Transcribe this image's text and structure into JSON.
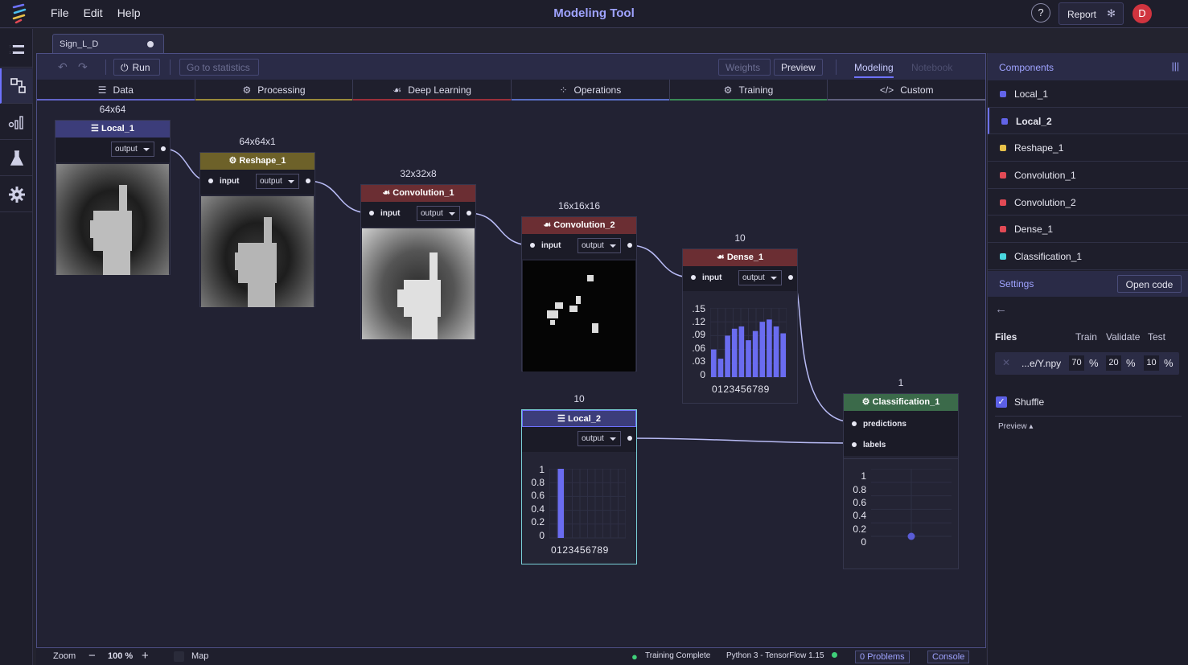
{
  "app": {
    "title": "Modeling Tool"
  },
  "menu": [
    "File",
    "Edit",
    "Help"
  ],
  "header": {
    "help": "?",
    "report": "Report",
    "avatar": "D"
  },
  "file_tab": {
    "name": "Sign_L_D"
  },
  "toolbar": {
    "run": "Run",
    "go_to_statistics": "Go to statistics",
    "weights": "Weights",
    "preview": "Preview",
    "modeling": "Modeling",
    "notebook": "Notebook"
  },
  "categories": [
    {
      "label": "Data",
      "icon": "database-icon",
      "color": "#6264c7"
    },
    {
      "label": "Processing",
      "icon": "gear-icon",
      "color": "#9a8a3a"
    },
    {
      "label": "Deep Learning",
      "icon": "brain-icon",
      "color": "#9b2f3a"
    },
    {
      "label": "Operations",
      "icon": "grid-icon",
      "color": "#5a6fc4"
    },
    {
      "label": "Training",
      "icon": "gear-icon",
      "color": "#3a8a56"
    },
    {
      "label": "Custom",
      "icon": "code-icon",
      "color": "#5f607e"
    }
  ],
  "nodes": {
    "local_1": {
      "title": "Local_1",
      "shape": "64x64",
      "output": "output",
      "color": "#3c3d7a"
    },
    "reshape_1": {
      "title": "Reshape_1",
      "shape": "64x64x1",
      "input": "input",
      "output": "output",
      "color": "#6d6129"
    },
    "convolution_1": {
      "title": "Convolution_1",
      "shape": "32x32x8",
      "input": "input",
      "output": "output",
      "color": "#6b2e33"
    },
    "convolution_2": {
      "title": "Convolution_2",
      "shape": "16x16x16",
      "input": "input",
      "output": "output",
      "color": "#6b2e33"
    },
    "dense_1": {
      "title": "Dense_1",
      "shape": "10",
      "input": "input",
      "output": "output",
      "color": "#6b2e33",
      "yticks": [
        ".15",
        ".12",
        ".09",
        ".06",
        ".03",
        "0"
      ],
      "xticks": "0123456789"
    },
    "local_2": {
      "title": "Local_2",
      "shape": "10",
      "output": "output",
      "color": "#3c3d7a",
      "yticks": [
        "1",
        "0.8",
        "0.6",
        "0.4",
        "0.2",
        "0"
      ],
      "xticks": "0123456789"
    },
    "classification_1": {
      "title": "Classification_1",
      "shape": "1",
      "color": "#3b6a4a",
      "predictions": "predictions",
      "labels": "labels",
      "yticks": [
        "1",
        "0.8",
        "0.6",
        "0.4",
        "0.2",
        "0"
      ]
    }
  },
  "chart_data": [
    {
      "type": "bar",
      "title": "",
      "categories": [
        "0",
        "1",
        "2",
        "3",
        "4",
        "5",
        "6",
        "7",
        "8",
        "9"
      ],
      "values": [
        0.06,
        0.04,
        0.09,
        0.105,
        0.11,
        0.08,
        0.1,
        0.12,
        0.125,
        0.11,
        0.095
      ],
      "series_color": "#6a6cf0",
      "ylim": [
        0,
        0.15
      ]
    },
    {
      "type": "bar",
      "title": "",
      "categories": [
        "0",
        "1",
        "2",
        "3",
        "4",
        "5",
        "6",
        "7",
        "8",
        "9"
      ],
      "values": [
        0,
        1,
        0,
        0,
        0,
        0,
        0,
        0,
        0,
        0
      ],
      "series_color": "#6a6cf0",
      "ylim": [
        0,
        1
      ]
    },
    {
      "type": "scatter",
      "title": "",
      "x": [
        0
      ],
      "y": [
        0
      ],
      "series_color": "#5a5cd6",
      "ylim": [
        0,
        1
      ]
    }
  ],
  "right_panel": {
    "components_title": "Components",
    "components": [
      {
        "name": "Local_1",
        "color": "#6264e8"
      },
      {
        "name": "Local_2",
        "color": "#6264e8"
      },
      {
        "name": "Reshape_1",
        "color": "#e8c24a"
      },
      {
        "name": "Convolution_1",
        "color": "#e24a55"
      },
      {
        "name": "Convolution_2",
        "color": "#e24a55"
      },
      {
        "name": "Dense_1",
        "color": "#e24a55"
      },
      {
        "name": "Classification_1",
        "color": "#4ad8e0"
      }
    ],
    "settings_title": "Settings",
    "open_code": "Open code",
    "files_label": "Files",
    "train": "Train",
    "validate": "Validate",
    "test": "Test",
    "file_name": "...e/Y.npy",
    "train_pct": "70",
    "validate_pct": "20",
    "test_pct": "10",
    "pct_sign": "%",
    "shuffle": "Shuffle",
    "preview": "Preview"
  },
  "status": {
    "zoom_label": "Zoom",
    "zoom_value": "100 %",
    "map": "Map",
    "training": "Training Complete",
    "kernel": "Python 3 - TensorFlow 1.15",
    "problems": "0 Problems",
    "console": "Console"
  }
}
